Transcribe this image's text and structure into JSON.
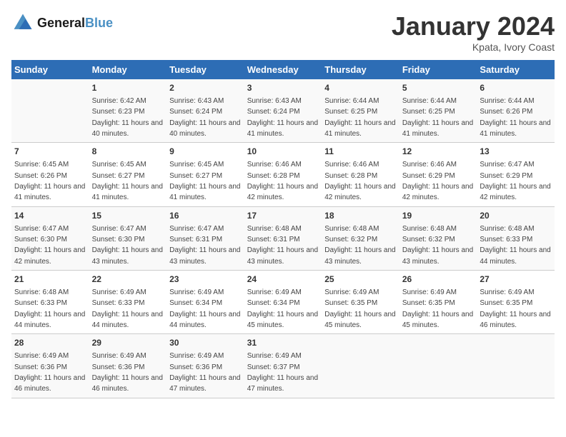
{
  "header": {
    "logo_line1": "General",
    "logo_line2": "Blue",
    "title": "January 2024",
    "subtitle": "Kpata, Ivory Coast"
  },
  "days_header": [
    "Sunday",
    "Monday",
    "Tuesday",
    "Wednesday",
    "Thursday",
    "Friday",
    "Saturday"
  ],
  "weeks": [
    [
      {
        "num": "",
        "sunrise": "",
        "sunset": "",
        "daylight": ""
      },
      {
        "num": "1",
        "sunrise": "Sunrise: 6:42 AM",
        "sunset": "Sunset: 6:23 PM",
        "daylight": "Daylight: 11 hours and 40 minutes."
      },
      {
        "num": "2",
        "sunrise": "Sunrise: 6:43 AM",
        "sunset": "Sunset: 6:24 PM",
        "daylight": "Daylight: 11 hours and 40 minutes."
      },
      {
        "num": "3",
        "sunrise": "Sunrise: 6:43 AM",
        "sunset": "Sunset: 6:24 PM",
        "daylight": "Daylight: 11 hours and 41 minutes."
      },
      {
        "num": "4",
        "sunrise": "Sunrise: 6:44 AM",
        "sunset": "Sunset: 6:25 PM",
        "daylight": "Daylight: 11 hours and 41 minutes."
      },
      {
        "num": "5",
        "sunrise": "Sunrise: 6:44 AM",
        "sunset": "Sunset: 6:25 PM",
        "daylight": "Daylight: 11 hours and 41 minutes."
      },
      {
        "num": "6",
        "sunrise": "Sunrise: 6:44 AM",
        "sunset": "Sunset: 6:26 PM",
        "daylight": "Daylight: 11 hours and 41 minutes."
      }
    ],
    [
      {
        "num": "7",
        "sunrise": "Sunrise: 6:45 AM",
        "sunset": "Sunset: 6:26 PM",
        "daylight": "Daylight: 11 hours and 41 minutes."
      },
      {
        "num": "8",
        "sunrise": "Sunrise: 6:45 AM",
        "sunset": "Sunset: 6:27 PM",
        "daylight": "Daylight: 11 hours and 41 minutes."
      },
      {
        "num": "9",
        "sunrise": "Sunrise: 6:45 AM",
        "sunset": "Sunset: 6:27 PM",
        "daylight": "Daylight: 11 hours and 41 minutes."
      },
      {
        "num": "10",
        "sunrise": "Sunrise: 6:46 AM",
        "sunset": "Sunset: 6:28 PM",
        "daylight": "Daylight: 11 hours and 42 minutes."
      },
      {
        "num": "11",
        "sunrise": "Sunrise: 6:46 AM",
        "sunset": "Sunset: 6:28 PM",
        "daylight": "Daylight: 11 hours and 42 minutes."
      },
      {
        "num": "12",
        "sunrise": "Sunrise: 6:46 AM",
        "sunset": "Sunset: 6:29 PM",
        "daylight": "Daylight: 11 hours and 42 minutes."
      },
      {
        "num": "13",
        "sunrise": "Sunrise: 6:47 AM",
        "sunset": "Sunset: 6:29 PM",
        "daylight": "Daylight: 11 hours and 42 minutes."
      }
    ],
    [
      {
        "num": "14",
        "sunrise": "Sunrise: 6:47 AM",
        "sunset": "Sunset: 6:30 PM",
        "daylight": "Daylight: 11 hours and 42 minutes."
      },
      {
        "num": "15",
        "sunrise": "Sunrise: 6:47 AM",
        "sunset": "Sunset: 6:30 PM",
        "daylight": "Daylight: 11 hours and 43 minutes."
      },
      {
        "num": "16",
        "sunrise": "Sunrise: 6:47 AM",
        "sunset": "Sunset: 6:31 PM",
        "daylight": "Daylight: 11 hours and 43 minutes."
      },
      {
        "num": "17",
        "sunrise": "Sunrise: 6:48 AM",
        "sunset": "Sunset: 6:31 PM",
        "daylight": "Daylight: 11 hours and 43 minutes."
      },
      {
        "num": "18",
        "sunrise": "Sunrise: 6:48 AM",
        "sunset": "Sunset: 6:32 PM",
        "daylight": "Daylight: 11 hours and 43 minutes."
      },
      {
        "num": "19",
        "sunrise": "Sunrise: 6:48 AM",
        "sunset": "Sunset: 6:32 PM",
        "daylight": "Daylight: 11 hours and 43 minutes."
      },
      {
        "num": "20",
        "sunrise": "Sunrise: 6:48 AM",
        "sunset": "Sunset: 6:33 PM",
        "daylight": "Daylight: 11 hours and 44 minutes."
      }
    ],
    [
      {
        "num": "21",
        "sunrise": "Sunrise: 6:48 AM",
        "sunset": "Sunset: 6:33 PM",
        "daylight": "Daylight: 11 hours and 44 minutes."
      },
      {
        "num": "22",
        "sunrise": "Sunrise: 6:49 AM",
        "sunset": "Sunset: 6:33 PM",
        "daylight": "Daylight: 11 hours and 44 minutes."
      },
      {
        "num": "23",
        "sunrise": "Sunrise: 6:49 AM",
        "sunset": "Sunset: 6:34 PM",
        "daylight": "Daylight: 11 hours and 44 minutes."
      },
      {
        "num": "24",
        "sunrise": "Sunrise: 6:49 AM",
        "sunset": "Sunset: 6:34 PM",
        "daylight": "Daylight: 11 hours and 45 minutes."
      },
      {
        "num": "25",
        "sunrise": "Sunrise: 6:49 AM",
        "sunset": "Sunset: 6:35 PM",
        "daylight": "Daylight: 11 hours and 45 minutes."
      },
      {
        "num": "26",
        "sunrise": "Sunrise: 6:49 AM",
        "sunset": "Sunset: 6:35 PM",
        "daylight": "Daylight: 11 hours and 45 minutes."
      },
      {
        "num": "27",
        "sunrise": "Sunrise: 6:49 AM",
        "sunset": "Sunset: 6:35 PM",
        "daylight": "Daylight: 11 hours and 46 minutes."
      }
    ],
    [
      {
        "num": "28",
        "sunrise": "Sunrise: 6:49 AM",
        "sunset": "Sunset: 6:36 PM",
        "daylight": "Daylight: 11 hours and 46 minutes."
      },
      {
        "num": "29",
        "sunrise": "Sunrise: 6:49 AM",
        "sunset": "Sunset: 6:36 PM",
        "daylight": "Daylight: 11 hours and 46 minutes."
      },
      {
        "num": "30",
        "sunrise": "Sunrise: 6:49 AM",
        "sunset": "Sunset: 6:36 PM",
        "daylight": "Daylight: 11 hours and 47 minutes."
      },
      {
        "num": "31",
        "sunrise": "Sunrise: 6:49 AM",
        "sunset": "Sunset: 6:37 PM",
        "daylight": "Daylight: 11 hours and 47 minutes."
      },
      {
        "num": "",
        "sunrise": "",
        "sunset": "",
        "daylight": ""
      },
      {
        "num": "",
        "sunrise": "",
        "sunset": "",
        "daylight": ""
      },
      {
        "num": "",
        "sunrise": "",
        "sunset": "",
        "daylight": ""
      }
    ]
  ]
}
